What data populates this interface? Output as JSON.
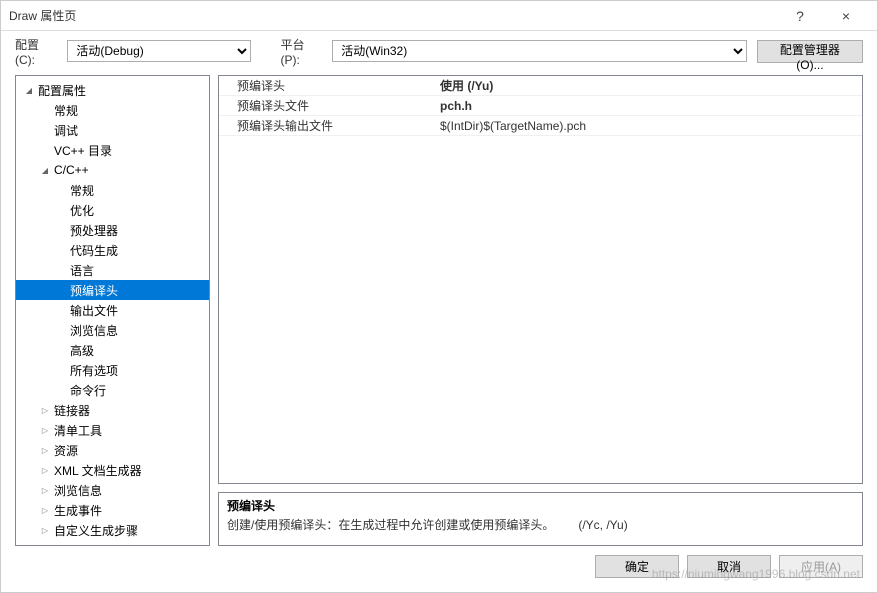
{
  "window": {
    "title": "Draw 属性页",
    "help_icon": "?",
    "close_icon": "×"
  },
  "toolbar": {
    "config_label": "配置(C):",
    "config_value": "活动(Debug)",
    "platform_label": "平台(P):",
    "platform_value": "活动(Win32)",
    "configmgr_label": "配置管理器(O)..."
  },
  "tree": [
    {
      "level": 0,
      "arrow": "open",
      "label": "配置属性",
      "name": "config-properties"
    },
    {
      "level": 1,
      "arrow": "none",
      "label": "常规",
      "name": "general"
    },
    {
      "level": 1,
      "arrow": "none",
      "label": "调试",
      "name": "debugging"
    },
    {
      "level": 1,
      "arrow": "none",
      "label": "VC++ 目录",
      "name": "vcpp-directories"
    },
    {
      "level": 1,
      "arrow": "open",
      "label": "C/C++",
      "name": "c-cpp"
    },
    {
      "level": 2,
      "arrow": "none",
      "label": "常规",
      "name": "cpp-general"
    },
    {
      "level": 2,
      "arrow": "none",
      "label": "优化",
      "name": "optimization"
    },
    {
      "level": 2,
      "arrow": "none",
      "label": "预处理器",
      "name": "preprocessor"
    },
    {
      "level": 2,
      "arrow": "none",
      "label": "代码生成",
      "name": "code-generation"
    },
    {
      "level": 2,
      "arrow": "none",
      "label": "语言",
      "name": "language"
    },
    {
      "level": 2,
      "arrow": "none",
      "label": "预编译头",
      "name": "precompiled-headers",
      "selected": true
    },
    {
      "level": 2,
      "arrow": "none",
      "label": "输出文件",
      "name": "output-files"
    },
    {
      "level": 2,
      "arrow": "none",
      "label": "浏览信息",
      "name": "browse-info"
    },
    {
      "level": 2,
      "arrow": "none",
      "label": "高级",
      "name": "advanced"
    },
    {
      "level": 2,
      "arrow": "none",
      "label": "所有选项",
      "name": "all-options"
    },
    {
      "level": 2,
      "arrow": "none",
      "label": "命令行",
      "name": "command-line"
    },
    {
      "level": 1,
      "arrow": "closed",
      "label": "链接器",
      "name": "linker"
    },
    {
      "level": 1,
      "arrow": "closed",
      "label": "清单工具",
      "name": "manifest-tool"
    },
    {
      "level": 1,
      "arrow": "closed",
      "label": "资源",
      "name": "resources"
    },
    {
      "level": 1,
      "arrow": "closed",
      "label": "XML 文档生成器",
      "name": "xml-doc-generator"
    },
    {
      "level": 1,
      "arrow": "closed",
      "label": "浏览信息",
      "name": "browse-info-2"
    },
    {
      "level": 1,
      "arrow": "closed",
      "label": "生成事件",
      "name": "build-events"
    },
    {
      "level": 1,
      "arrow": "closed",
      "label": "自定义生成步骤",
      "name": "custom-build-step"
    }
  ],
  "properties": [
    {
      "name": "预编译头",
      "value": "使用 (/Yu)",
      "bold": true
    },
    {
      "name": "预编译头文件",
      "value": "pch.h",
      "bold": true
    },
    {
      "name": "预编译头输出文件",
      "value": "$(IntDir)$(TargetName).pch",
      "bold": false
    }
  ],
  "description": {
    "title": "预编译头",
    "body": "创建/使用预编译头：在生成过程中允许创建或使用预编译头。  (/Yc, /Yu)"
  },
  "footer": {
    "ok": "确定",
    "cancel": "取消",
    "apply": "应用(A)"
  },
  "watermark": "https://niumingwang1996.blog.csdn.net"
}
